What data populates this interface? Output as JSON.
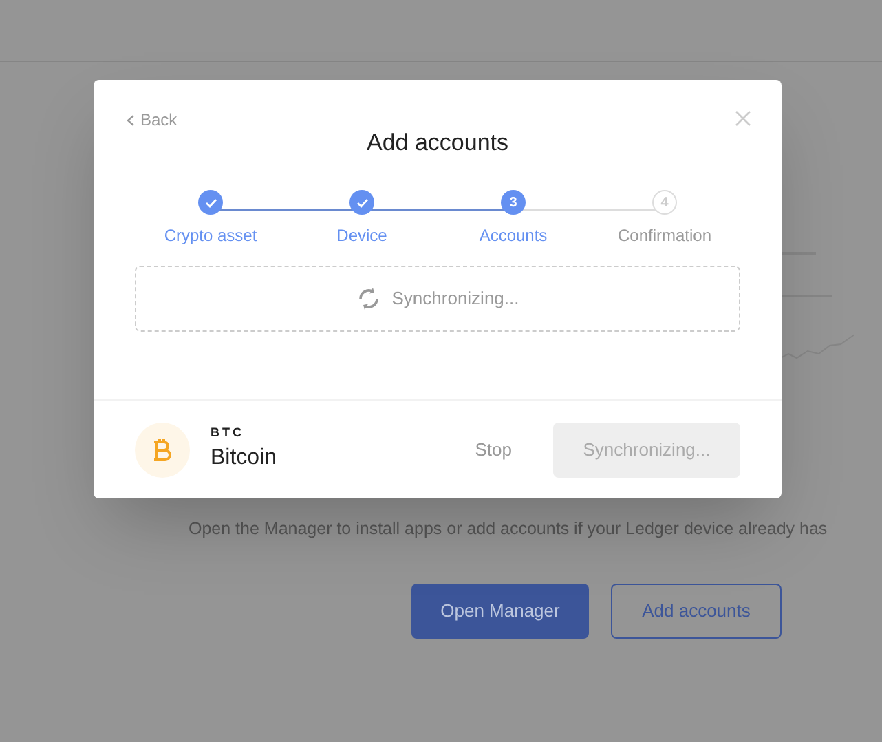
{
  "background": {
    "description": "Open the Manager to install apps or add accounts if your Ledger device already has",
    "buttons": [
      {
        "label": "Open Manager",
        "kind": "primary"
      },
      {
        "label": "Add accounts",
        "kind": "outline"
      }
    ]
  },
  "modal": {
    "back": "Back",
    "title": "Add accounts",
    "steps": [
      {
        "label": "Crypto asset",
        "completed": true
      },
      {
        "label": "Device",
        "completed": true
      },
      {
        "number": "3",
        "label": "Accounts",
        "completed": false,
        "active": true
      },
      {
        "number": "4",
        "label": "Confirmation",
        "completed": false,
        "active": false
      }
    ],
    "sync_message": "Synchronizing...",
    "footer": {
      "ticker": "BTC",
      "name": "Bitcoin",
      "stop": "Stop",
      "action": {
        "label": "Synchronizing...",
        "disabled": true
      }
    }
  }
}
